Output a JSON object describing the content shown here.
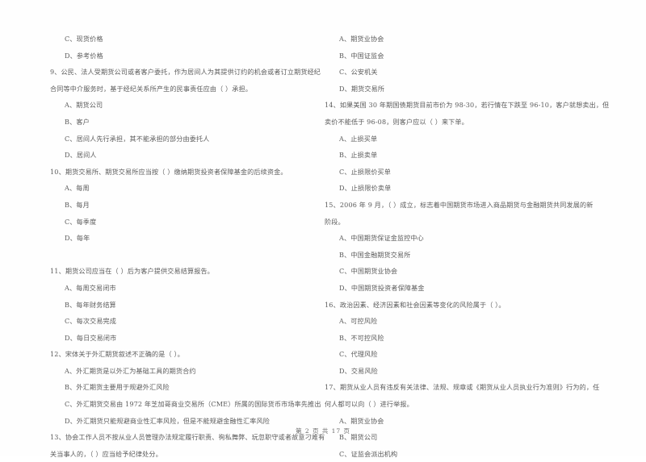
{
  "document": {
    "type": "scanned-exam-paper",
    "language": "zh-CN",
    "footer": "第 2 页 共 17 页"
  },
  "left_column": [
    {
      "kind": "option",
      "text": "C、现货价格"
    },
    {
      "kind": "option",
      "text": "D、参考价格"
    },
    {
      "kind": "question",
      "text": "9、公民、法人受期货公司或者客户委托，作为居间人为其提供订约的机会或者订立期货经纪"
    },
    {
      "kind": "cont",
      "text": "合同等中介服务时，基于经纪关系所产生的民事责任应由（      ）承担。"
    },
    {
      "kind": "option",
      "text": "A、期货公司"
    },
    {
      "kind": "option",
      "text": "B、客户"
    },
    {
      "kind": "option",
      "text": "C、居间人先行承担，其不能承担的部分由委托人"
    },
    {
      "kind": "option",
      "text": "D、居间人"
    },
    {
      "kind": "question",
      "text": "10、期货交易所、期货交易所应当按（      ）缴纳期货投资者保障基金的后续资金。"
    },
    {
      "kind": "option",
      "text": "A、每周"
    },
    {
      "kind": "option",
      "text": "B、每月"
    },
    {
      "kind": "option",
      "text": "C、每季度"
    },
    {
      "kind": "option",
      "text": "D、每年"
    },
    {
      "kind": "blank",
      "text": ""
    },
    {
      "kind": "question",
      "text": "11、期货公司应当在（      ）后为客户提供交易结算报告。"
    },
    {
      "kind": "option",
      "text": "A、每周交易闭市"
    },
    {
      "kind": "option",
      "text": "B、每年财务结算"
    },
    {
      "kind": "option",
      "text": "C、每次交易完成"
    },
    {
      "kind": "option",
      "text": "D、每日交易闭市"
    },
    {
      "kind": "question",
      "text": "12、宋体关于外汇期货叙述不正确的是（      ）。"
    },
    {
      "kind": "option",
      "text": "A、外汇期货是以外汇为基础工具的期货合约"
    },
    {
      "kind": "option",
      "text": "B、外汇期货主要用于规避外汇风险"
    },
    {
      "kind": "option",
      "text": "C、外汇期货交易由 1972 年芝加哥商业交易所（CME）所属的国际货币市场率先推出"
    },
    {
      "kind": "option",
      "text": "D、外汇期货只能规避商业性汇率风险，但是不能规避金融性汇率风险"
    },
    {
      "kind": "question",
      "text": "13、协会工作人员不按从业人员管理办法规定履行职责、徇私舞弊、玩忽职守或者故意刁难有"
    },
    {
      "kind": "cont",
      "text": "关当事人的，（      ）应当给予纪律处分。"
    }
  ],
  "right_column": [
    {
      "kind": "option",
      "text": "A、期货业协会"
    },
    {
      "kind": "option",
      "text": "B、中国证监会"
    },
    {
      "kind": "option",
      "text": "C、公安机关"
    },
    {
      "kind": "option",
      "text": "D、期货交易所"
    },
    {
      "kind": "question",
      "text": "14、如果美国 30 年期国债期货目前市价为 98-30，若行情在下跌至 96-10，客户就想卖出，但"
    },
    {
      "kind": "cont",
      "text": "卖价不能低于 96-08，则客户应以（      ）来下单。"
    },
    {
      "kind": "option",
      "text": "A、止损买单"
    },
    {
      "kind": "option",
      "text": "B、止损卖单"
    },
    {
      "kind": "option",
      "text": "C、止损限价买单"
    },
    {
      "kind": "option",
      "text": "D、止损限价卖单"
    },
    {
      "kind": "question",
      "text": "15、2006 年 9 月，（      ）成立，标志着中国期货市场进入商品期货与金融期货共同发展的新"
    },
    {
      "kind": "cont",
      "text": "阶段。"
    },
    {
      "kind": "option",
      "text": "A、中国期货保证金监控中心"
    },
    {
      "kind": "option",
      "text": "B、中国金融期货交易所"
    },
    {
      "kind": "option",
      "text": "C、中国期货业协会"
    },
    {
      "kind": "option",
      "text": "D、中国期货投资者保障基金"
    },
    {
      "kind": "question",
      "text": "16、政治因素、经济因素和社会因素等变化的风险属于（      ）。"
    },
    {
      "kind": "option",
      "text": "A、可控风险"
    },
    {
      "kind": "option",
      "text": "B、不可控风险"
    },
    {
      "kind": "option",
      "text": "C、代理风险"
    },
    {
      "kind": "option",
      "text": "D、交易风险"
    },
    {
      "kind": "question",
      "text": "17、期货从业人员有违反有关法律、法规、规章或《期货从业人员执业行为准则》行为的，任"
    },
    {
      "kind": "cont",
      "text": "何人都可以向（      ）进行举报。"
    },
    {
      "kind": "option",
      "text": "A、期货业协会"
    },
    {
      "kind": "option",
      "text": "B、期货公司"
    },
    {
      "kind": "option",
      "text": "C、证监会派出机构"
    }
  ]
}
